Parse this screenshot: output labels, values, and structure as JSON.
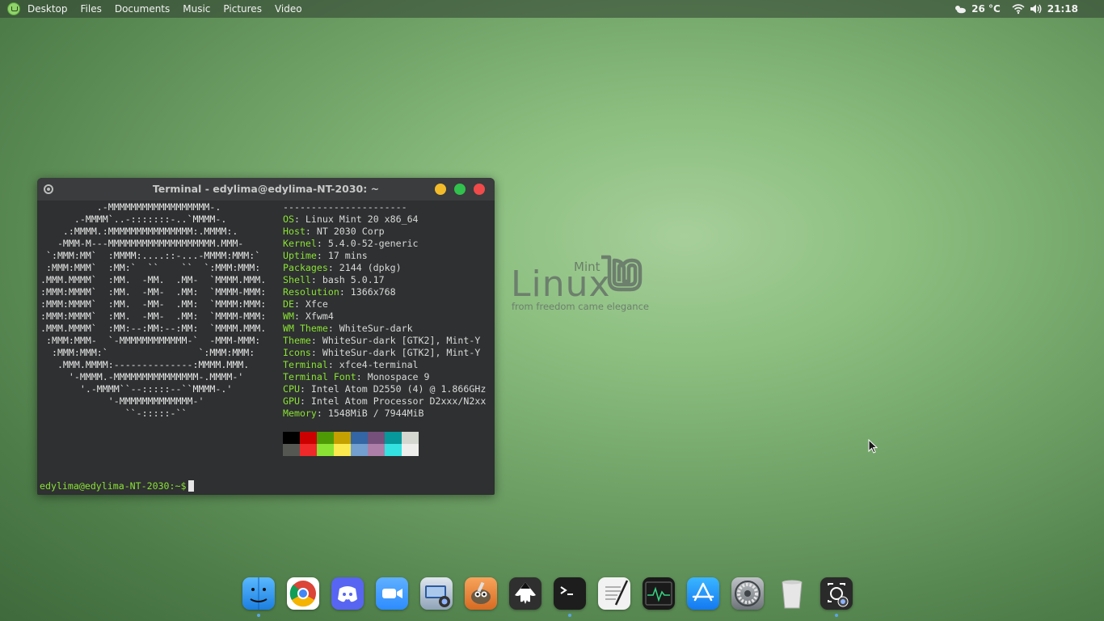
{
  "panel": {
    "places": [
      "Desktop",
      "Files",
      "Documents",
      "Music",
      "Pictures",
      "Video"
    ],
    "weather": "26 °C",
    "clock": "21:18"
  },
  "logo": {
    "linux": "Linux",
    "mint": "Mint",
    "tagline": "from freedom came elegance"
  },
  "terminal": {
    "title": "Terminal - edylima@edylima-NT-2030: ~",
    "separator": "----------------------",
    "info": [
      {
        "key": "OS",
        "value": "Linux Mint 20 x86_64"
      },
      {
        "key": "Host",
        "value": "NT 2030 Corp"
      },
      {
        "key": "Kernel",
        "value": "5.4.0-52-generic"
      },
      {
        "key": "Uptime",
        "value": "17 mins"
      },
      {
        "key": "Packages",
        "value": "2144 (dpkg)"
      },
      {
        "key": "Shell",
        "value": "bash 5.0.17"
      },
      {
        "key": "Resolution",
        "value": "1366x768"
      },
      {
        "key": "DE",
        "value": "Xfce"
      },
      {
        "key": "WM",
        "value": "Xfwm4"
      },
      {
        "key": "WM Theme",
        "value": "WhiteSur-dark"
      },
      {
        "key": "Theme",
        "value": "WhiteSur-dark [GTK2], Mint-Y"
      },
      {
        "key": "Icons",
        "value": "WhiteSur-dark [GTK2], Mint-Y"
      },
      {
        "key": "Terminal",
        "value": "xfce4-terminal"
      },
      {
        "key": "Terminal Font",
        "value": "Monospace 9"
      },
      {
        "key": "CPU",
        "value": "Intel Atom D2550 (4) @ 1.866GHz"
      },
      {
        "key": "GPU",
        "value": "Intel Atom Processor D2xxx/N2xx"
      },
      {
        "key": "Memory",
        "value": "1548MiB / 7944MiB"
      }
    ],
    "palette_top": [
      "#000000",
      "#cc0000",
      "#4e9a06",
      "#c4a000",
      "#3465a4",
      "#75507b",
      "#06989a",
      "#d3d7cf"
    ],
    "palette_bottom": [
      "#555753",
      "#ef2929",
      "#8ae234",
      "#fce94f",
      "#729fcf",
      "#ad7fa8",
      "#34e2e2",
      "#eeeeec"
    ],
    "prompt": "edylima@edylima-NT-2030:~$"
  },
  "ascii_art": [
    "          .-MMMMMMMMMMMMMMMMMM-.",
    "      .-MMMM`..-:::::::-..`MMMM-.",
    "    .:MMMM.:MMMMMMMMMMMMMMM:.MMMM:.",
    "   -MMM-M---MMMMMMMMMMMMMMMMMMM.MMM-",
    " `:MMM:MM`  :MMMM:....::-...-MMMM:MMM:`",
    " :MMM:MMM`  :MM:`  ``    ``  `:MMM:MMM:",
    ".MMM.MMMM`  :MM.  -MM.  .MM-  `MMMM.MMM.",
    ":MMM:MMMM`  :MM.  -MM-  .MM:  `MMMM-MMM:",
    ":MMM:MMMM`  :MM.  -MM-  .MM:  `MMMM:MMM:",
    ":MMM:MMMM`  :MM.  -MM-  .MM:  `MMMM-MMM:",
    ".MMM.MMMM`  :MM:--:MM:--:MM:  `MMMM.MMM.",
    " :MMM:MMM-  `-MMMMMMMMMMMM-`  -MMM-MMM:",
    "  :MMM:MMM:`                `:MMM:MMM:",
    "   .MMM.MMMM:--------------:MMMM.MMM.",
    "     '-MMMM.-MMMMMMMMMMMMMMM-.MMMM-'",
    "       '.-MMMM``--:::::--``MMMM-.'",
    "            '-MMMMMMMMMMMMM-'",
    "               ``-:::::-``"
  ],
  "dock": [
    {
      "name": "finder-icon",
      "bg": "linear-gradient(#5ab8ff,#1c7fe0)"
    },
    {
      "name": "chrome-icon",
      "bg": "#ffffff"
    },
    {
      "name": "discord-icon",
      "bg": "#5865f2"
    },
    {
      "name": "zoom-icon",
      "bg": "linear-gradient(#5fb0ff,#2d8cff)"
    },
    {
      "name": "screenshot-tool-icon",
      "bg": "linear-gradient(#dfe6ee,#8fa3b8)"
    },
    {
      "name": "gimp-icon",
      "bg": "linear-gradient(#f7a35b,#d86b22)"
    },
    {
      "name": "inkscape-icon",
      "bg": "#2f2f2f"
    },
    {
      "name": "terminal-icon",
      "bg": "#1d1d1d"
    },
    {
      "name": "text-editor-icon",
      "bg": "#f2f2f2"
    },
    {
      "name": "system-monitor-icon",
      "bg": "#1a1a1a"
    },
    {
      "name": "app-store-icon",
      "bg": "linear-gradient(#3ab6ff,#1479f2)"
    },
    {
      "name": "system-settings-icon",
      "bg": "linear-gradient(#bfc3c7,#6d7378)"
    },
    {
      "name": "trash-icon",
      "bg": "transparent"
    },
    {
      "name": "camera-app-icon",
      "bg": "#2a2a2a"
    }
  ],
  "dock_running": [
    true,
    false,
    false,
    false,
    false,
    false,
    false,
    true,
    false,
    false,
    false,
    false,
    false,
    true
  ]
}
